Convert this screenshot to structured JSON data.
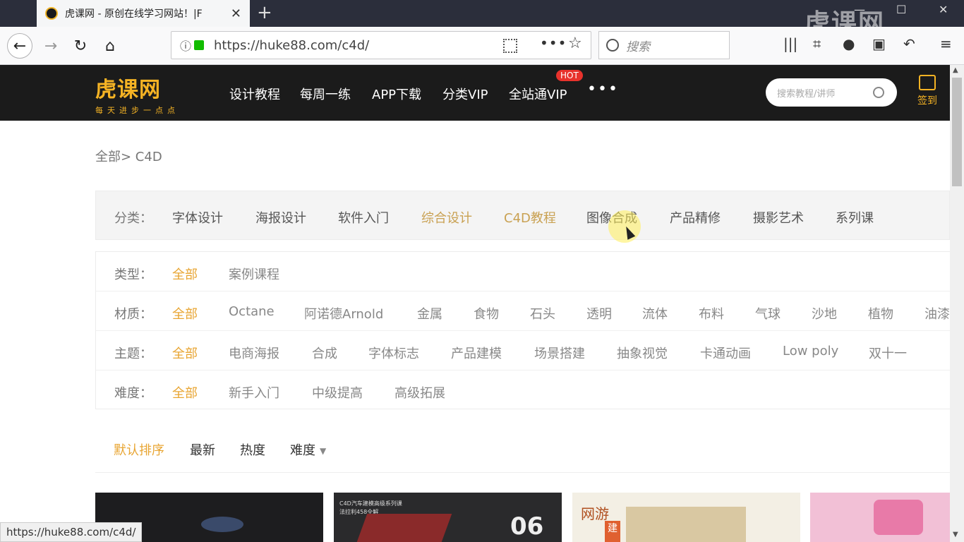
{
  "browser": {
    "tab_title": "虎课网 - 原创在线学习网站！|F",
    "new_tab": "+",
    "window_controls": {
      "minimize": "—",
      "maximize": "☐",
      "close": "✕"
    },
    "watermark": "虎课网",
    "url": "https://huke88.com/c4d/",
    "search_placeholder": "搜索",
    "url_more": "•••",
    "status_url": "https://huke88.com/c4d/"
  },
  "site": {
    "logo_text": "虎课网",
    "logo_slogan": "每天进步一点点",
    "nav": [
      "设计教程",
      "每周一练",
      "APP下载",
      "分类VIP",
      "全站通VIP"
    ],
    "hot_badge": "HOT",
    "more": "•••",
    "search_placeholder": "搜索教程/讲师",
    "signin_label": "签到"
  },
  "breadcrumb": "全部> C4D",
  "category": {
    "label": "分类：",
    "items": [
      "字体设计",
      "海报设计",
      "软件入门",
      "综合设计",
      "C4D教程",
      "图像合成",
      "产品精修",
      "摄影艺术",
      "系列课"
    ]
  },
  "filters": {
    "type": {
      "label": "类型：",
      "items": [
        "全部",
        "案例课程"
      ]
    },
    "material": {
      "label": "材质：",
      "items": [
        "全部",
        "Octane",
        "阿诺德Arnold",
        "金属",
        "食物",
        "石头",
        "透明",
        "流体",
        "布料",
        "气球",
        "沙地",
        "植物",
        "油漆"
      ]
    },
    "theme": {
      "label": "主题：",
      "items": [
        "全部",
        "电商海报",
        "合成",
        "字体标志",
        "产品建模",
        "场景搭建",
        "抽象视觉",
        "卡通动画",
        "Low poly",
        "双十一"
      ]
    },
    "difficulty": {
      "label": "难度：",
      "items": [
        "全部",
        "新手入门",
        "中级提高",
        "高级拓展"
      ]
    }
  },
  "sort": [
    "默认排序",
    "最新",
    "热度",
    "难度"
  ],
  "cards": [
    {
      "caption": ""
    },
    {
      "caption": "C4D汽车建模高级系列课",
      "sub": "法拉利458全解",
      "number": "06"
    },
    {
      "caption": "网游",
      "badge": "建"
    },
    {
      "caption": ""
    }
  ],
  "colors": {
    "header_bg": "#1b1b1b",
    "accent_gold": "#f5b324",
    "active_orange": "#e8a532",
    "hot_red": "#e8322c"
  }
}
